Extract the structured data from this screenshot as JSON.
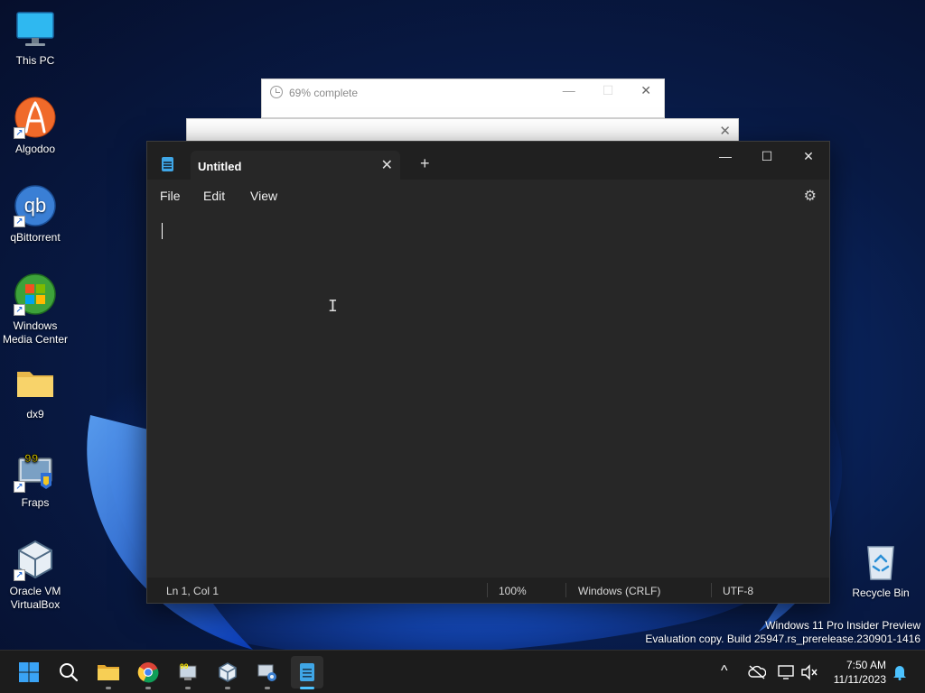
{
  "desktop": {
    "icons": [
      {
        "label": "This PC",
        "icon": "monitor-icon",
        "shortcut": false
      },
      {
        "label": "Algodoo",
        "icon": "algodoo-icon",
        "shortcut": true
      },
      {
        "label": "qBittorrent",
        "icon": "qbittorrent-icon",
        "shortcut": true
      },
      {
        "label_line1": "Windows",
        "label_line2": "Media Center",
        "icon": "windows-media-center-icon",
        "shortcut": true
      },
      {
        "label": "dx9",
        "icon": "folder-icon",
        "shortcut": false
      },
      {
        "label": "Fraps",
        "icon": "fraps-icon",
        "shortcut": true,
        "badge": "99"
      },
      {
        "label_line1": "Oracle VM",
        "label_line2": "VirtualBox",
        "icon": "virtualbox-icon",
        "shortcut": true
      }
    ],
    "recycle_bin": {
      "label": "Recycle Bin"
    },
    "watermark": {
      "line1": "Windows 11 Pro Insider Preview",
      "line2": "Evaluation copy. Build 25947.rs_prerelease.230901-1416"
    },
    "qb_glyph": "qb"
  },
  "progress_window": {
    "title": "69% complete",
    "percent": 69,
    "minimize": "—",
    "maximize": "☐",
    "close": "✕"
  },
  "second_window": {
    "close": "✕"
  },
  "notepad": {
    "tab_title": "Untitled",
    "tab_close": "✕",
    "new_tab": "+",
    "caption": {
      "minimize": "—",
      "maximize": "☐",
      "close": "✕"
    },
    "menu": {
      "file": "File",
      "edit": "Edit",
      "view": "View"
    },
    "settings_glyph": "⚙",
    "content": "",
    "ibeam": "I",
    "status": {
      "position": "Ln 1, Col 1",
      "zoom": "100%",
      "line_ending": "Windows (CRLF)",
      "encoding": "UTF-8"
    }
  },
  "taskbar": {
    "apps": [
      {
        "name": "start",
        "icon": "windows-start-icon"
      },
      {
        "name": "search",
        "icon": "search-icon"
      },
      {
        "name": "file-explorer",
        "icon": "folder-icon",
        "running": true
      },
      {
        "name": "chrome",
        "icon": "chrome-icon",
        "running": true
      },
      {
        "name": "fraps",
        "icon": "fraps-icon",
        "running": true
      },
      {
        "name": "virtualbox",
        "icon": "virtualbox-icon",
        "running": true
      },
      {
        "name": "installer",
        "icon": "installer-icon",
        "running": true
      },
      {
        "name": "notepad",
        "icon": "notepad-icon",
        "running": true,
        "active": true
      }
    ],
    "tray": {
      "chevron": "^",
      "time": "7:50 AM",
      "date": "11/11/2023"
    }
  },
  "colors": {
    "accent": "#4cc2ff",
    "notepad_bg": "#272727",
    "taskbar_bg": "#1c1c1c"
  }
}
